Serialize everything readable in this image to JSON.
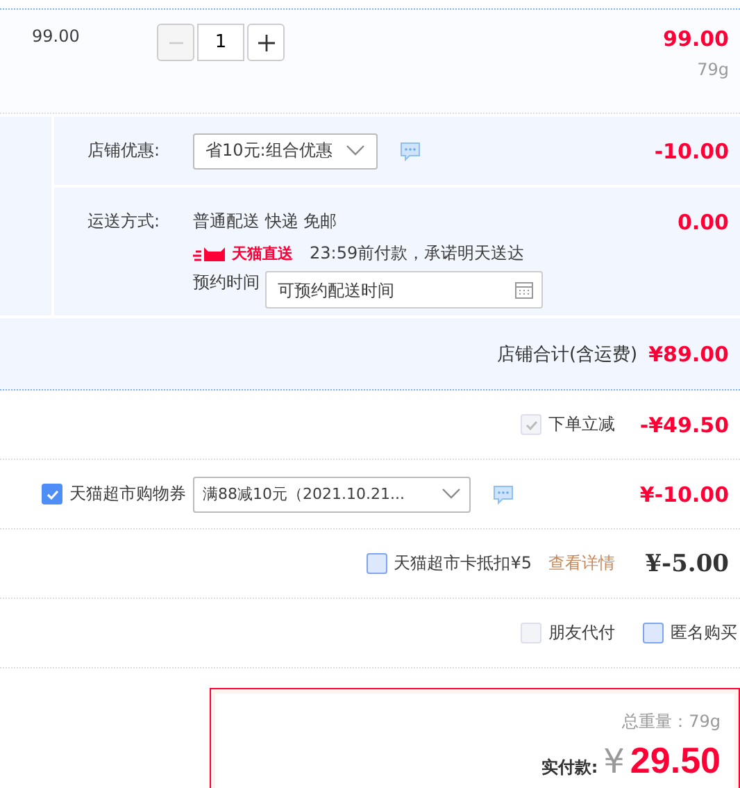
{
  "item": {
    "unit_price": "99.00",
    "quantity": "1",
    "minus_disabled": true,
    "subtotal": "99.00",
    "weight": "79g"
  },
  "shop_discount": {
    "label": "店铺优惠:",
    "select": "省10元:组合优惠",
    "amount": "-10.00"
  },
  "shipping": {
    "label": "运送方式:",
    "method": "普通配送 快递 免邮",
    "badge": "天猫直送",
    "promise": "23:59前付款，承诺明天送达",
    "schedule_label": "预约时间",
    "schedule_placeholder": "可预约配送时间",
    "amount": "0.00"
  },
  "shop_total": {
    "label": "店铺合计(含运费)",
    "amount": "¥89.00"
  },
  "instant_discount": {
    "label": "下单立减",
    "checked": true,
    "disabled": true,
    "amount": "-¥49.50"
  },
  "coupon": {
    "label": "天猫超市购物券",
    "checked": true,
    "select": "满88减10元（2021.10.21...",
    "amount": "¥-10.00"
  },
  "card": {
    "label": "天猫超市卡抵扣¥5",
    "checked": false,
    "link": "查看详情",
    "amount": "¥-5.00"
  },
  "options": [
    {
      "label": "朋友代付",
      "checked": false,
      "disabled": true
    },
    {
      "label": "匿名购买",
      "checked": false,
      "disabled": false
    }
  ],
  "total": {
    "weight": "总重量：79g",
    "pay_label": "实付款:",
    "currency": "¥",
    "amount": "29.50"
  }
}
